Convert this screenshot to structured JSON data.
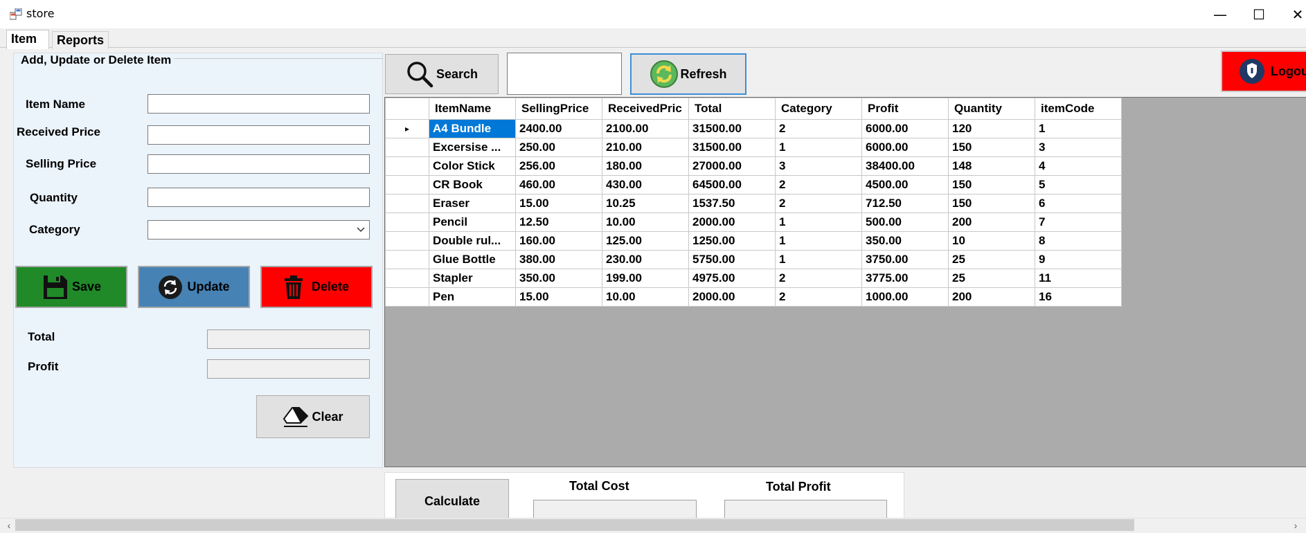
{
  "window": {
    "title": "store",
    "minimize_glyph": "—",
    "maximize_glyph": "☐",
    "close_glyph": "✕"
  },
  "tabs": [
    {
      "label": "Item",
      "active": true
    },
    {
      "label": "Reports",
      "active": false
    }
  ],
  "form": {
    "group_title": "Add, Update or Delete Item",
    "fields": {
      "item_name": {
        "label": "Item Name",
        "value": ""
      },
      "received_price": {
        "label": "Received Price",
        "value": ""
      },
      "selling_price": {
        "label": "Selling Price",
        "value": ""
      },
      "quantity": {
        "label": "Quantity",
        "value": ""
      },
      "category": {
        "label": "Category",
        "value": ""
      }
    },
    "buttons": {
      "save": "Save",
      "update": "Update",
      "delete": "Delete",
      "clear": "Clear"
    },
    "total_label": "Total",
    "total_value": "",
    "profit_label": "Profit",
    "profit_value": ""
  },
  "toolbar": {
    "search_label": "Search",
    "search_value": "",
    "refresh_label": "Refresh",
    "logout_label": "Logout"
  },
  "grid": {
    "columns": [
      "ItemName",
      "SellingPrice",
      "ReceivedPric",
      "Total",
      "Category",
      "Profit",
      "Quantity",
      "itemCode"
    ],
    "rows": [
      [
        "A4 Bundle",
        "2400.00",
        "2100.00",
        "31500.00",
        "2",
        "6000.00",
        "120",
        "1"
      ],
      [
        "Excersise ...",
        "250.00",
        "210.00",
        "31500.00",
        "1",
        "6000.00",
        "150",
        "3"
      ],
      [
        "Color Stick",
        "256.00",
        "180.00",
        "27000.00",
        "3",
        "38400.00",
        "148",
        "4"
      ],
      [
        "CR Book",
        "460.00",
        "430.00",
        "64500.00",
        "2",
        "4500.00",
        "150",
        "5"
      ],
      [
        "Eraser",
        "15.00",
        "10.25",
        "1537.50",
        "2",
        "712.50",
        "150",
        "6"
      ],
      [
        "Pencil",
        "12.50",
        "10.00",
        "2000.00",
        "1",
        "500.00",
        "200",
        "7"
      ],
      [
        "Double rul...",
        "160.00",
        "125.00",
        "1250.00",
        "1",
        "350.00",
        "10",
        "8"
      ],
      [
        "Glue Bottle",
        "380.00",
        "230.00",
        "5750.00",
        "1",
        "3750.00",
        "25",
        "9"
      ],
      [
        "Stapler",
        "350.00",
        "199.00",
        "4975.00",
        "2",
        "3775.00",
        "25",
        "11"
      ],
      [
        "Pen",
        "15.00",
        "10.00",
        "2000.00",
        "2",
        "1000.00",
        "200",
        "16"
      ]
    ],
    "selected_row": 0,
    "row_indicator": "▸"
  },
  "calc": {
    "calculate_label": "Calculate",
    "total_cost_label": "Total Cost",
    "total_cost_value": "",
    "total_profit_label": "Total Profit",
    "total_profit_value": ""
  },
  "scrollbar": {
    "left_glyph": "‹",
    "right_glyph": "›"
  },
  "colors": {
    "save": "#218a28",
    "update": "#4682b4",
    "delete": "#ff0000",
    "logout": "#ff0000",
    "selection": "#0078d7"
  }
}
